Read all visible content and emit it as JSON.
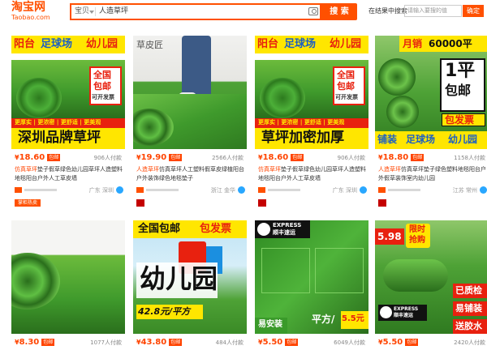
{
  "header": {
    "logo_text": "淘宝网",
    "logo_sub": "Taobao.com",
    "scope": "宝贝",
    "query": "人造草坪",
    "search_button": "搜 索",
    "within_label": "在结果中搜索",
    "within_placeholder": "请输入要搜的值",
    "within_button": "确定"
  },
  "products": [
    {
      "price": "18.60",
      "badge": "包邮",
      "buyers": "906人付款",
      "title_hl": "仿真草坪",
      "title": "垫子假草绿色幼儿园草坪人造塑料地毯阳台户外人工草皮墙",
      "location": "广东 深圳",
      "tag": "掌柜热卖",
      "overlay": {
        "top_left": "阳台",
        "top_mid": "足球场",
        "top_right": "幼儿园",
        "badge1": "全国",
        "badge2": "包邮",
        "badge3": "可开发票",
        "strip": "更厚实 | 更浓密 | 更舒适 | 更美观",
        "bottom": "深圳品牌草坪"
      }
    },
    {
      "price": "19.90",
      "badge": "包邮",
      "buyers": "2566人付款",
      "title_hl": "人造草坪",
      "title": "仿真草坪人工塑料假草皮绿植阳台户外装饰绿色地毯垫子",
      "location": "浙江 金华",
      "tag": "",
      "overlay": {
        "brand": "草皮匠"
      }
    },
    {
      "price": "18.60",
      "badge": "包邮",
      "buyers": "906人付款",
      "title_hl": "仿真草坪",
      "title": "垫子假草绿色幼儿园草坪人造塑料地毯阳台户外人工草皮墙",
      "location": "广东 深圳",
      "tag": "",
      "overlay": {
        "top_left": "阳台",
        "top_mid": "足球场",
        "top_right": "幼儿园",
        "badge1": "全国",
        "badge2": "包邮",
        "badge3": "可开发票",
        "strip": "更厚实 | 更浓密 | 更舒适 | 更美观",
        "bottom": "草坪加密加厚"
      }
    },
    {
      "price": "18.80",
      "badge": "包邮",
      "buyers": "1158人付款",
      "title_hl": "人造草坪",
      "title": "仿真草坪垫子绿色塑料地毯阳台户外假草装饰室内幼儿园",
      "location": "江苏 常州",
      "tag": "",
      "overlay": {
        "sales_label": "月销",
        "sales_value": "60000平",
        "big1": "1平",
        "big2": "包邮",
        "invoice": "包发票",
        "bar1": "铺装",
        "bar2": "足球场",
        "bar3": "幼儿园"
      }
    },
    {
      "price": "8.30",
      "badge": "包邮",
      "buyers": "1077人付款",
      "overlay": {}
    },
    {
      "price": "43.80",
      "badge": "包邮",
      "buyers": "484人付款",
      "overlay": {
        "top1": "全国包邮",
        "top2": "包发票",
        "big": "幼儿园",
        "price_tag": "42.8元/平方"
      }
    },
    {
      "price": "5.50",
      "badge": "包邮",
      "buyers": "6049人付款",
      "overlay": {
        "express1": "EXPRESS",
        "express2": "顺丰速运",
        "b1": "易安装",
        "b2": "平方/",
        "b3": "5.5元"
      }
    },
    {
      "price": "5.50",
      "badge": "包邮",
      "buyers": "2420人付款",
      "overlay": {
        "p1": "5.98",
        "p2": "限时",
        "p3": "抢购",
        "express1": "EXPRESS",
        "express2": "顺丰速运",
        "s1": "已质检",
        "s2": "易铺装",
        "s3": "送胶水"
      }
    }
  ],
  "colors": {
    "brand": "#ff5000",
    "price": "#ff4400",
    "grass": "#3f9a2c",
    "grass_dark": "#2a6e1c",
    "yellow": "#ffe600",
    "red": "#e8210f"
  }
}
